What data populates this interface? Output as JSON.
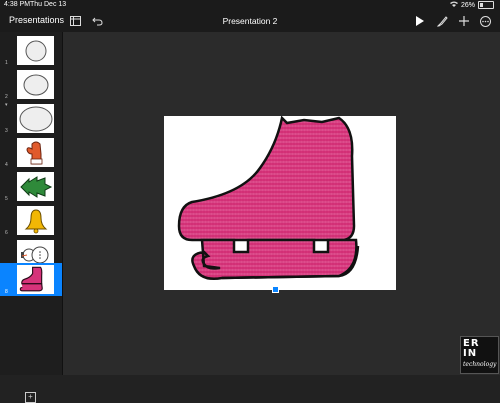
{
  "status": {
    "time": "4:38 PM",
    "date": "Thu Dec 13",
    "battery": "26%",
    "battery_level": 0.26
  },
  "toolbar": {
    "presentations_label": "Presentations",
    "title": "Presentation 2"
  },
  "colors": {
    "accent": "#0a84ff",
    "skate": "#d6337a",
    "mitten": "#e05a2c",
    "tree": "#2f8a3a",
    "bell": "#f2b705"
  },
  "slides": [
    {
      "number": "1",
      "icon": "oval-outline-icon"
    },
    {
      "number": "2",
      "icon": "oval-outline-icon"
    },
    {
      "number": "3",
      "icon": "oval-outline-icon"
    },
    {
      "number": "4",
      "icon": "mitten-icon"
    },
    {
      "number": "5",
      "icon": "christmas-tree-icon"
    },
    {
      "number": "6",
      "icon": "bell-icon"
    },
    {
      "number": "7",
      "icon": "snowman-icon"
    },
    {
      "number": "8",
      "icon": "ice-skate-icon",
      "selected": true
    }
  ],
  "logo": {
    "line1": "ER",
    "line2": "IN",
    "line3": "technology"
  }
}
